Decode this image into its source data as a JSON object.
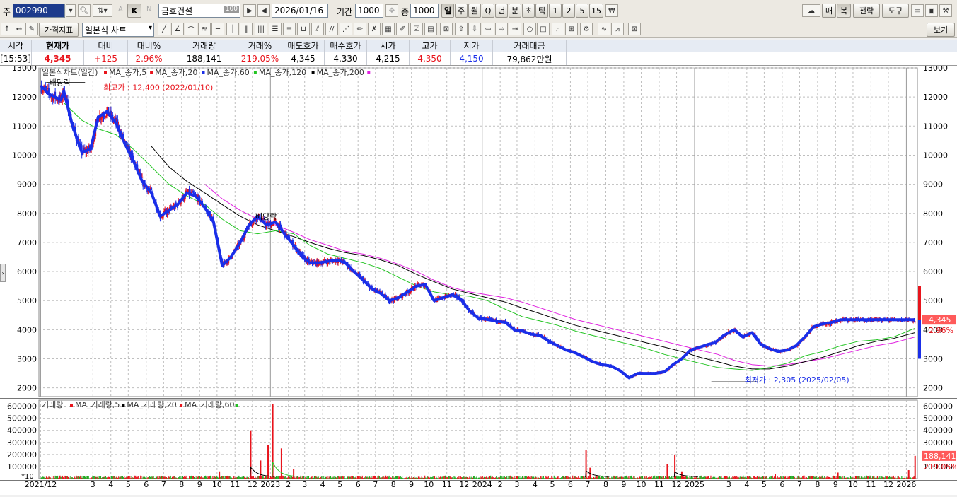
{
  "toolbar1": {
    "mode_label": "주",
    "code": "002990",
    "name": "금호건설",
    "name_badge": "100",
    "date": "2026/01/16",
    "period_label": "기간",
    "period_value": "1000",
    "count_label": "종",
    "count_value": "1000",
    "letter_a": "A",
    "letter_k": "K",
    "letter_n": "N",
    "periods": [
      "일",
      "주",
      "월",
      "Q",
      "년",
      "분",
      "초",
      "틱",
      "1",
      "2",
      "5",
      "15"
    ],
    "right_buttons": [
      "매",
      "복",
      "전략",
      "도구"
    ]
  },
  "toolbar2": {
    "price_indicator": "가격지표",
    "chart_type": "일본식 차트",
    "view_label": "보기"
  },
  "quote": {
    "headers": [
      "시각",
      "현재가",
      "대비",
      "대비%",
      "거래량",
      "거래%",
      "매도호가",
      "매수호가",
      "시가",
      "고가",
      "저가",
      "거래대금"
    ],
    "values": [
      "[15:53]",
      "4,345",
      "+125",
      "2.96%",
      "188,141",
      "219.05%",
      "4,345",
      "4,330",
      "4,215",
      "4,350",
      "4,150",
      "79,862만원"
    ]
  },
  "colors": {
    "up": "#e8141c",
    "down": "#1a2ee8",
    "ma5": "#e8141c",
    "ma20": "#22c422",
    "ma60": "#1a2ee8",
    "ma120": "#000000",
    "ma200": "#e020e0",
    "vol_up": "#e8141c",
    "vol_down": "#22a822",
    "grid": "#bfbfbf"
  },
  "chart_data": {
    "type": "line",
    "price_panel": {
      "legend_title": "일본식차트(일간)",
      "legend": [
        {
          "name": "MA_종가,5",
          "color": "#e8141c"
        },
        {
          "name": "MA_종가,20",
          "color": "#e8141c"
        },
        {
          "name": "MA_종가,60",
          "color": "#1a2ee8"
        },
        {
          "name": "MA_종가,120",
          "color": "#22c422"
        },
        {
          "name": "MA_종가,200",
          "color": "#000000"
        }
      ],
      "legend_tail_color": "#e020e0",
      "ylim": [
        1700,
        13000
      ],
      "yticks": [
        2000,
        3000,
        4000,
        5000,
        6000,
        7000,
        8000,
        9000,
        10000,
        11000,
        12000,
        13000
      ],
      "series": [
        {
          "name": "종가",
          "color": "#1a2ee8",
          "x": [
            "2021-12-01",
            "2021-12-15",
            "2022-01-05",
            "2022-01-10",
            "2022-01-25",
            "2022-02-10",
            "2022-02-25",
            "2022-03-10",
            "2022-03-25",
            "2022-04-10",
            "2022-04-25",
            "2022-05-10",
            "2022-05-25",
            "2022-06-10",
            "2022-06-25",
            "2022-07-10",
            "2022-07-25",
            "2022-08-10",
            "2022-08-25",
            "2022-09-10",
            "2022-09-25",
            "2022-10-10",
            "2022-10-25",
            "2022-11-10",
            "2022-11-25",
            "2022-12-10",
            "2022-12-25",
            "2023-01-10",
            "2023-01-25",
            "2023-02-10",
            "2023-02-25",
            "2023-03-10",
            "2023-03-25",
            "2023-04-10",
            "2023-04-25",
            "2023-05-10",
            "2023-05-25",
            "2023-06-10",
            "2023-06-25",
            "2023-07-10",
            "2023-07-25",
            "2023-08-10",
            "2023-08-25",
            "2023-09-10",
            "2023-09-25",
            "2023-10-10",
            "2023-10-25",
            "2023-11-10",
            "2023-11-25",
            "2023-12-10",
            "2023-12-25",
            "2024-01-10",
            "2024-01-25",
            "2024-02-10",
            "2024-02-25",
            "2024-03-10",
            "2024-03-25",
            "2024-04-10",
            "2024-04-25",
            "2024-05-10",
            "2024-05-25",
            "2024-06-10",
            "2024-06-25",
            "2024-07-10",
            "2024-07-25",
            "2024-08-10",
            "2024-08-25",
            "2024-09-10",
            "2024-09-25",
            "2024-10-10",
            "2024-10-25",
            "2024-11-10",
            "2024-11-25",
            "2024-12-10",
            "2024-12-25",
            "2025-01-10",
            "2025-01-25",
            "2025-02-05",
            "2025-02-20",
            "2025-03-10",
            "2025-03-25",
            "2025-04-10",
            "2025-04-25",
            "2025-05-10",
            "2025-05-25",
            "2025-06-10",
            "2025-06-25",
            "2025-07-10",
            "2025-07-25",
            "2025-08-10",
            "2025-08-25",
            "2025-09-10",
            "2025-09-25",
            "2025-10-10",
            "2025-10-25",
            "2025-11-10",
            "2025-11-25",
            "2025-12-10",
            "2025-12-25",
            "2026-01-10",
            "2026-01-16"
          ],
          "y": [
            12400,
            12100,
            11900,
            12200,
            11000,
            10100,
            10200,
            11300,
            11500,
            11100,
            10400,
            9800,
            9100,
            8700,
            7900,
            8100,
            8300,
            8700,
            8600,
            8200,
            7700,
            6200,
            6500,
            7000,
            7600,
            7900,
            7600,
            7700,
            7300,
            6900,
            6500,
            6300,
            6300,
            6350,
            6400,
            6300,
            6000,
            5700,
            5400,
            5250,
            5000,
            5100,
            5300,
            5500,
            5550,
            5000,
            5100,
            5200,
            5050,
            4650,
            4400,
            4350,
            4300,
            4250,
            4000,
            3950,
            3850,
            3800,
            3600,
            3450,
            3300,
            3200,
            3050,
            2900,
            2800,
            2750,
            2600,
            2350,
            2500,
            2500,
            2500,
            2550,
            2800,
            3000,
            3300,
            3400,
            3500,
            3550,
            3800,
            4000,
            3750,
            3900,
            3500,
            3350,
            3250,
            3300,
            3450,
            3750,
            4100,
            4200,
            4250,
            4345,
            4345,
            4345,
            4345,
            4345,
            4345,
            4345,
            4345,
            4345,
            4345
          ],
          "note": ""
        },
        {
          "name": "MA_종가,120",
          "color": "#22c422",
          "x": [
            "2022-01-10",
            "2022-02-10",
            "2022-03-10",
            "2022-04-10",
            "2022-05-10",
            "2022-06-10",
            "2022-07-10",
            "2022-08-10",
            "2022-09-10",
            "2022-10-10",
            "2022-11-10",
            "2022-12-10",
            "2023-01-10",
            "2023-02-10",
            "2023-03-10",
            "2023-04-10",
            "2023-05-10",
            "2023-06-10",
            "2023-07-10",
            "2023-08-10",
            "2023-09-10",
            "2023-10-10",
            "2023-11-10",
            "2023-12-10",
            "2024-01-10",
            "2024-02-10",
            "2024-03-10",
            "2024-04-10",
            "2024-05-10",
            "2024-06-10",
            "2024-07-10",
            "2024-08-10",
            "2024-09-10",
            "2024-10-10",
            "2024-11-10",
            "2024-12-10",
            "2025-01-10",
            "2025-02-10",
            "2025-03-10",
            "2025-04-10",
            "2025-05-10",
            "2025-06-10",
            "2025-07-10",
            "2025-08-10",
            "2025-09-10",
            "2025-10-10",
            "2025-11-10",
            "2025-12-10",
            "2026-01-16"
          ],
          "y": [
            11800,
            11200,
            10900,
            10700,
            10200,
            9600,
            9000,
            8600,
            8300,
            7800,
            7400,
            7300,
            7400,
            7300,
            6900,
            6600,
            6450,
            6300,
            6100,
            5800,
            5500,
            5300,
            5200,
            5150,
            5000,
            4700,
            4450,
            4300,
            4150,
            3950,
            3800,
            3650,
            3500,
            3350,
            3150,
            3000,
            2850,
            2700,
            2650,
            2600,
            2700,
            2850,
            3100,
            3250,
            3450,
            3600,
            3650,
            3750,
            4050
          ]
        },
        {
          "name": "MA_종가,200",
          "color": "#000000",
          "x": [
            "2022-06-10",
            "2022-07-10",
            "2022-08-10",
            "2022-09-10",
            "2022-10-10",
            "2022-11-10",
            "2022-12-10",
            "2023-01-10",
            "2023-02-10",
            "2023-03-10",
            "2023-04-10",
            "2023-05-10",
            "2023-06-10",
            "2023-07-10",
            "2023-08-10",
            "2023-09-10",
            "2023-10-10",
            "2023-11-10",
            "2023-12-10",
            "2024-01-10",
            "2024-02-10",
            "2024-03-10",
            "2024-04-10",
            "2024-05-10",
            "2024-06-10",
            "2024-07-10",
            "2024-08-10",
            "2024-09-10",
            "2024-10-10",
            "2024-11-10",
            "2024-12-10",
            "2025-01-10",
            "2025-02-10",
            "2025-03-10",
            "2025-04-10",
            "2025-05-10",
            "2025-06-10",
            "2025-07-10",
            "2025-08-10",
            "2025-09-10",
            "2025-10-10",
            "2025-11-10",
            "2025-12-10",
            "2026-01-16"
          ],
          "y": [
            10300,
            9600,
            9100,
            8700,
            8300,
            7900,
            7600,
            7400,
            7200,
            7000,
            6800,
            6650,
            6550,
            6400,
            6200,
            5900,
            5650,
            5400,
            5250,
            5100,
            4950,
            4750,
            4550,
            4350,
            4150,
            4000,
            3850,
            3700,
            3550,
            3400,
            3250,
            3050,
            2900,
            2750,
            2650,
            2650,
            2750,
            2900,
            3050,
            3250,
            3450,
            3600,
            3700,
            3900
          ]
        },
        {
          "name": "MA_종가,60",
          "color": "#e020e0",
          "x": [
            "2022-09-10",
            "2022-10-10",
            "2022-11-10",
            "2022-12-10",
            "2023-01-10",
            "2023-02-10",
            "2023-03-10",
            "2023-04-10",
            "2023-05-10",
            "2023-06-10",
            "2023-07-10",
            "2023-08-10",
            "2023-09-10",
            "2023-10-10",
            "2023-11-10",
            "2023-12-10",
            "2024-01-10",
            "2024-02-10",
            "2024-03-10",
            "2024-04-10",
            "2024-05-10",
            "2024-06-10",
            "2024-07-10",
            "2024-08-10",
            "2024-09-10",
            "2024-10-10",
            "2024-11-10",
            "2024-12-10",
            "2025-01-10",
            "2025-02-10",
            "2025-03-10",
            "2025-04-10",
            "2025-05-10",
            "2025-06-10",
            "2025-07-10",
            "2025-08-10",
            "2025-09-10",
            "2025-10-10",
            "2025-11-10",
            "2025-12-10",
            "2026-01-16"
          ],
          "y": [
            9000,
            8500,
            8100,
            7800,
            7600,
            7350,
            7100,
            6900,
            6700,
            6600,
            6450,
            6250,
            6000,
            5700,
            5450,
            5300,
            5200,
            5100,
            4950,
            4750,
            4550,
            4350,
            4200,
            4050,
            3900,
            3750,
            3600,
            3450,
            3300,
            3150,
            2950,
            2800,
            2750,
            2800,
            2900,
            3000,
            3150,
            3300,
            3450,
            3550,
            3750
          ]
        }
      ],
      "annotations": [
        {
          "text": "최고가 : 12,400 (2022/01/10)",
          "x": "2022-01-10",
          "y": 12400,
          "color": "#e8141c"
        },
        {
          "text": "최저가 : 2,305 (2025/02/05)",
          "x": "2025-02-05",
          "y": 2305,
          "color": "#1a2ee8"
        },
        {
          "text": "배당락",
          "x": "2021-12-28",
          "y": 12500
        },
        {
          "text": "배당락",
          "x": "2022-12-28",
          "y": 7900
        }
      ],
      "last_price_tag": "4,345",
      "last_change_tag": "2.96%"
    },
    "volume_panel": {
      "legend_title": "거래량",
      "legend": [
        {
          "name": "MA_거래량,5",
          "color": "#e8141c"
        },
        {
          "name": "MA_거래량,20",
          "color": "#000000"
        },
        {
          "name": "MA_거래량,60",
          "color": "#e8141c"
        }
      ],
      "legend_tail_color": "#22c422",
      "ylim": [
        0,
        650000
      ],
      "yticks": [
        100000,
        200000,
        300000,
        400000,
        500000,
        600000
      ],
      "unit_label": "*10",
      "spikes": [
        {
          "x": "2022-10-05",
          "y": 60000
        },
        {
          "x": "2022-11-28",
          "y": 400000
        },
        {
          "x": "2022-12-15",
          "y": 150000
        },
        {
          "x": "2022-12-28",
          "y": 280000
        },
        {
          "x": "2023-01-05",
          "y": 620000
        },
        {
          "x": "2023-01-20",
          "y": 250000
        },
        {
          "x": "2023-02-10",
          "y": 80000
        },
        {
          "x": "2024-06-28",
          "y": 240000
        },
        {
          "x": "2024-07-05",
          "y": 90000
        },
        {
          "x": "2024-11-15",
          "y": 120000
        },
        {
          "x": "2024-11-28",
          "y": 200000
        },
        {
          "x": "2024-12-10",
          "y": 60000
        },
        {
          "x": "2025-05-20",
          "y": 40000
        },
        {
          "x": "2025-09-05",
          "y": 50000
        },
        {
          "x": "2026-01-05",
          "y": 70000
        },
        {
          "x": "2026-01-16",
          "y": 188141
        }
      ],
      "last_volume_tag": "188,141",
      "last_ratio_tag": "219.05%"
    },
    "x_axis_labels": [
      {
        "x": "2021-12-01",
        "label": "2021/12"
      },
      {
        "x": "2022-03-01",
        "label": "3"
      },
      {
        "x": "2022-04-01",
        "label": "4"
      },
      {
        "x": "2022-05-01",
        "label": "5"
      },
      {
        "x": "2022-06-01",
        "label": "6"
      },
      {
        "x": "2022-07-01",
        "label": "7"
      },
      {
        "x": "2022-08-01",
        "label": "8"
      },
      {
        "x": "2022-09-01",
        "label": "9"
      },
      {
        "x": "2022-10-01",
        "label": "10"
      },
      {
        "x": "2022-11-01",
        "label": "11"
      },
      {
        "x": "2022-12-01",
        "label": "12"
      },
      {
        "x": "2023-01-01",
        "label": "2023"
      },
      {
        "x": "2023-02-01",
        "label": "2"
      },
      {
        "x": "2023-03-01",
        "label": "3"
      },
      {
        "x": "2023-04-01",
        "label": "4"
      },
      {
        "x": "2023-05-01",
        "label": "5"
      },
      {
        "x": "2023-06-01",
        "label": "6"
      },
      {
        "x": "2023-07-01",
        "label": "7"
      },
      {
        "x": "2023-08-01",
        "label": "8"
      },
      {
        "x": "2023-09-01",
        "label": "9"
      },
      {
        "x": "2023-10-01",
        "label": "10"
      },
      {
        "x": "2023-11-01",
        "label": "11"
      },
      {
        "x": "2023-12-01",
        "label": "12"
      },
      {
        "x": "2024-01-01",
        "label": "2024"
      },
      {
        "x": "2024-02-01",
        "label": "2"
      },
      {
        "x": "2024-03-01",
        "label": "3"
      },
      {
        "x": "2024-04-01",
        "label": "4"
      },
      {
        "x": "2024-05-01",
        "label": "5"
      },
      {
        "x": "2024-06-01",
        "label": "6"
      },
      {
        "x": "2024-07-01",
        "label": "7"
      },
      {
        "x": "2024-08-01",
        "label": "8"
      },
      {
        "x": "2024-09-01",
        "label": "9"
      },
      {
        "x": "2024-10-01",
        "label": "10"
      },
      {
        "x": "2024-11-01",
        "label": "11"
      },
      {
        "x": "2024-12-01",
        "label": "12"
      },
      {
        "x": "2025-01-01",
        "label": "2025"
      },
      {
        "x": "2025-03-01",
        "label": "3"
      },
      {
        "x": "2025-04-01",
        "label": "4"
      },
      {
        "x": "2025-05-01",
        "label": "5"
      },
      {
        "x": "2025-06-01",
        "label": "6"
      },
      {
        "x": "2025-07-01",
        "label": "7"
      },
      {
        "x": "2025-08-01",
        "label": "8"
      },
      {
        "x": "2025-09-01",
        "label": "9"
      },
      {
        "x": "2025-10-01",
        "label": "10"
      },
      {
        "x": "2025-11-01",
        "label": "11"
      },
      {
        "x": "2025-12-01",
        "label": "12"
      },
      {
        "x": "2026-01-01",
        "label": "2026"
      }
    ],
    "x_range": [
      "2021-11-28",
      "2026-01-20"
    ],
    "grid": true
  }
}
